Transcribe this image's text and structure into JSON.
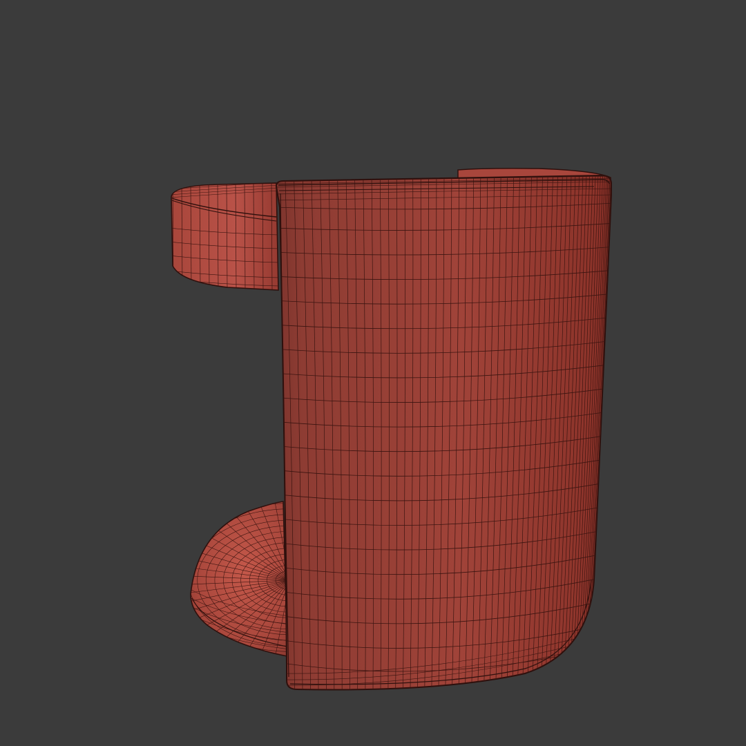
{
  "viewport": {
    "background": "#3b3b3b"
  },
  "model": {
    "description_icon": "wireframe-cylinder-table-model",
    "colors": {
      "surface": "#a8463c",
      "surface_light": "#b9574a",
      "surface_dark": "#7a2e27",
      "wire": "#3a1410",
      "top_face": "#b04a3f"
    }
  }
}
